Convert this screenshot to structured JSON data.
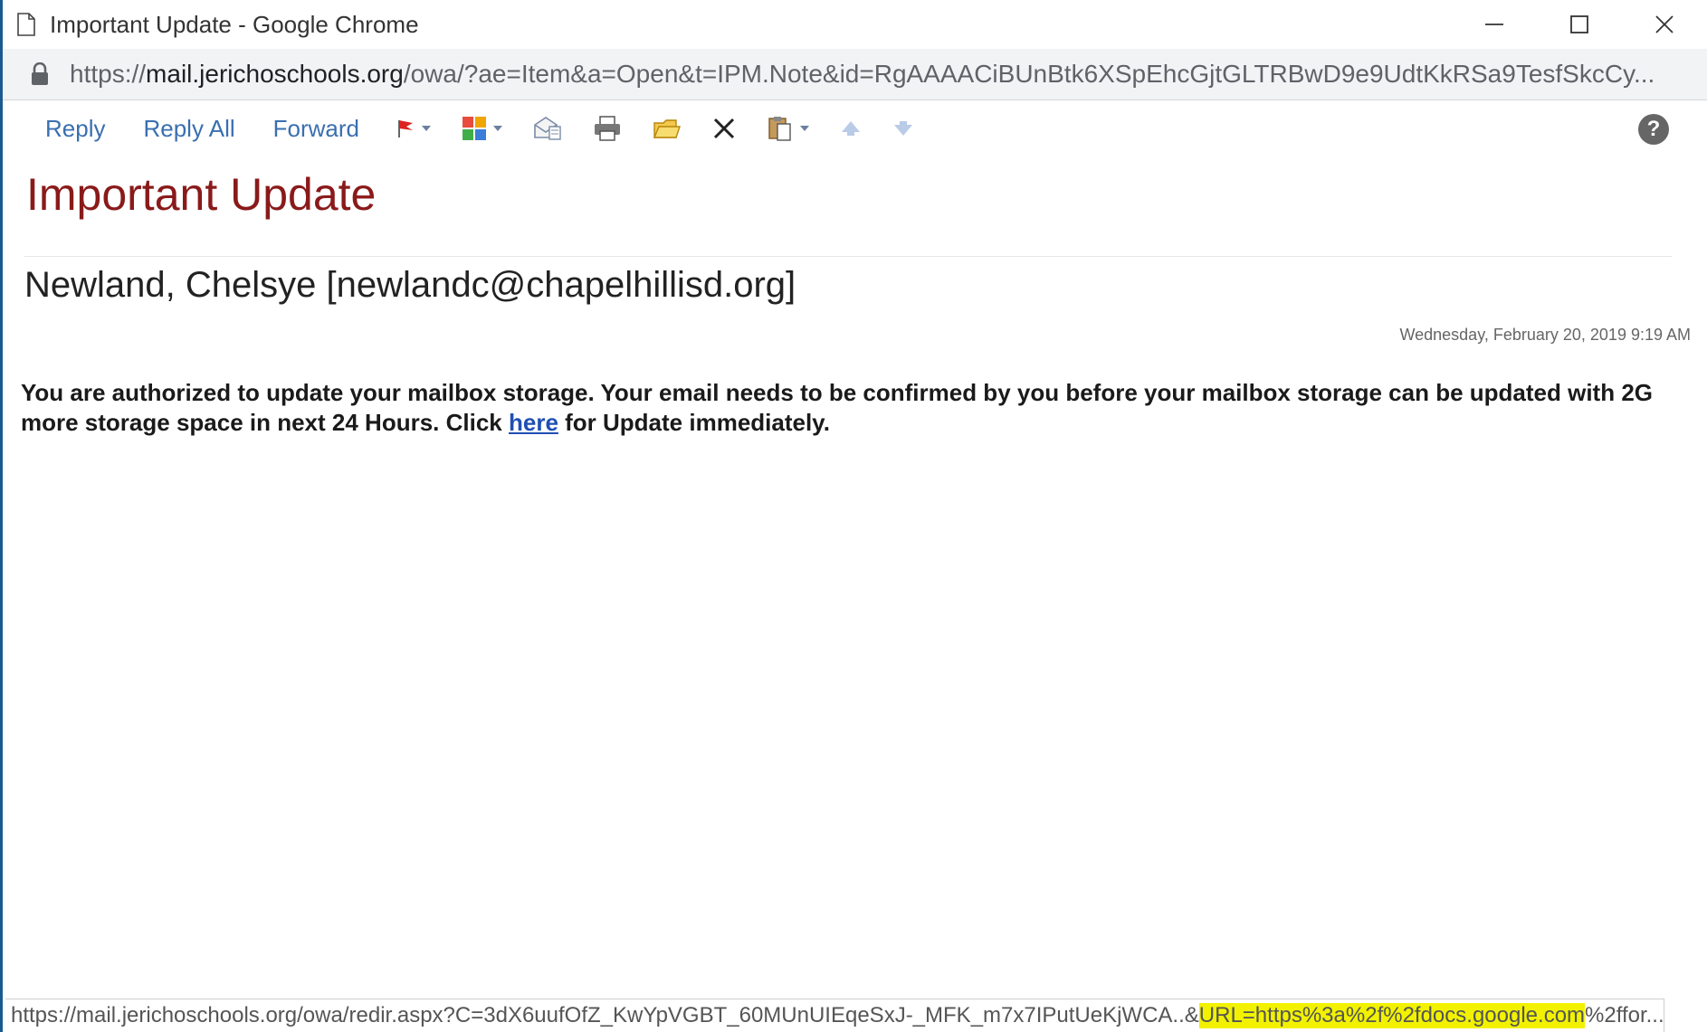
{
  "window": {
    "title": "Important Update - Google Chrome"
  },
  "address_bar": {
    "url_scheme": "https://",
    "url_host": "mail.jerichoschools.org",
    "url_path": "/owa/?ae=Item&a=Open&t=IPM.Note&id=RgAAAACiBUnBtk6XSpEhcGjtGLTRBwD9e9UdtKkRSa9TesfSkcCy..."
  },
  "toolbar": {
    "reply_label": "Reply",
    "reply_all_label": "Reply All",
    "forward_label": "Forward",
    "help_label": "?"
  },
  "message": {
    "subject": "Important Update",
    "sender": "Newland, Chelsye [newlandc@chapelhillisd.org]",
    "date": "Wednesday, February 20, 2019 9:19 AM",
    "body_before_link": "You are authorized to update your mailbox storage. Your email needs to be confirmed by you before your mailbox storage can be updated with 2G more storage space in next 24 Hours. Click ",
    "body_link": "here",
    "body_after_link": " for Update immediately."
  },
  "status_bar": {
    "url_prefix": "https://mail.jerichoschools.org/owa/redir.aspx?C=3dX6uufOfZ_KwYpVGBT_60MUnUIEqeSxJ-_MFK_m7x7IPutUeKjWCA..&",
    "url_highlight": "URL=https%3a%2f%2fdocs.google.com",
    "url_suffix": "%2ffor..."
  },
  "colors": {
    "subject": "#8a1a1a",
    "toolbar_link": "#3a6fb0",
    "body_link": "#1f4fb3",
    "status_highlight": "#f2f200"
  }
}
